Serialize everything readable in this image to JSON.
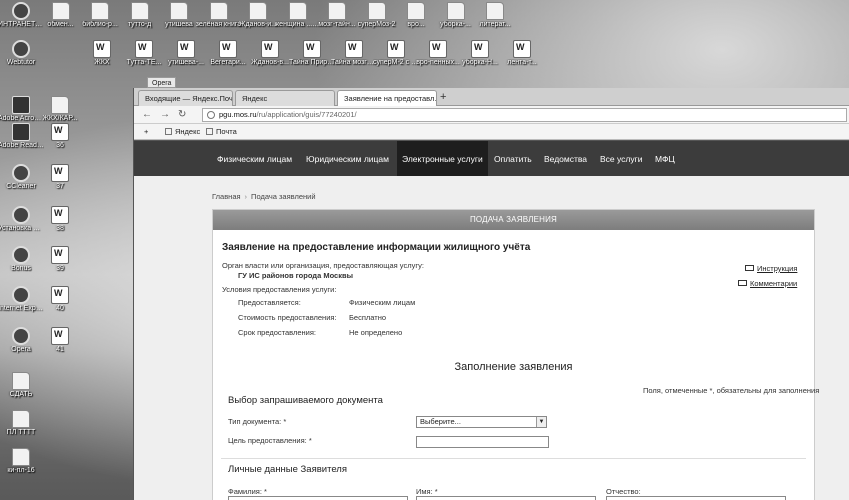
{
  "desktop": {
    "row1": [
      "ИНТРАНЕТ АСТ ЭКС...",
      "обмен...",
      "библио-р...",
      "тутто-д",
      "утишева",
      "зелёная книга",
      "Жданов-и...",
      "женщина ... дело",
      "мозг-тайн...",
      "суперМоз-2",
      "вро...",
      "уборка-...",
      "литерат..."
    ],
    "row2": [
      "Webtutor",
      "ЖКХ",
      "Тутта-ТЕ...",
      "утишева-...",
      "Вегетари...",
      "Жданов-в...",
      "Тайна Природы",
      "Тайна мозга-в...",
      "суперМ-2 с ДОБОЕМ",
      "вро-пенных...",
      "уборка-Н...",
      "лента-т..."
    ],
    "left": [
      "Adobe Acrobat...",
      "ЖКХ/КАР...",
      "Adobe Reader X",
      "36",
      "CCleaner",
      "37",
      "Установка Exchange...",
      "38",
      "Bonus",
      "39",
      "Internet Explorer",
      "40",
      "Opera",
      "41",
      "СДАТЬ",
      "ПЛ ТТТТ",
      "ки-пл-16"
    ]
  },
  "browser": {
    "opera_label": "Opera",
    "tabs": [
      {
        "label": "Входящие — Яндекс.Почта",
        "close": "×"
      },
      {
        "label": "Яндекс",
        "close": "×"
      },
      {
        "label": "Заявление на предоставл...",
        "close": "×"
      }
    ],
    "new_tab": "+",
    "url_host": "pgu.mos.ru",
    "url_path": "/ru/application/guis/77240201/",
    "bookmarks": [
      "Яндекс",
      "Почта"
    ]
  },
  "site": {
    "nav": [
      "Физическим лицам",
      "Юридическим лицам",
      "Электронные услуги",
      "Оплатить",
      "Ведомства",
      "Все услуги",
      "МФЦ"
    ],
    "breadcrumbs": [
      "Главная",
      "Подача заявлений"
    ],
    "card_header": "ПОДАЧА ЗАЯВЛЕНИЯ",
    "title": "Заявление на предоставление информации жилищного учёта",
    "authority_label": "Орган власти или организация, предоставляющая услугу:",
    "authority_value": "ГУ ИС районов города Москвы",
    "conditions_label": "Условия предоставления услуги:",
    "conditions": [
      {
        "k": "Предоставляется:",
        "v": "Физическим лицам"
      },
      {
        "k": "Стоимость предоставления:",
        "v": "Бесплатно"
      },
      {
        "k": "Срок предоставления:",
        "v": "Не определено"
      }
    ],
    "instruction_link": "Инструкция",
    "comments_link": "Комментарии",
    "form_title": "Заполнение заявления",
    "required_note": "Поля, отмеченные *, обязательны для заполнения",
    "section_doc": "Выбор запрашиваемого документа",
    "doc_type_label": "Тип документа: *",
    "doc_type_value": "Выберите...",
    "purpose_label": "Цель предоставления: *",
    "section_personal": "Личные данные Заявителя",
    "surname_label": "Фамилия: *",
    "name_label": "Имя: *",
    "patronymic_label": "Отчество:"
  }
}
